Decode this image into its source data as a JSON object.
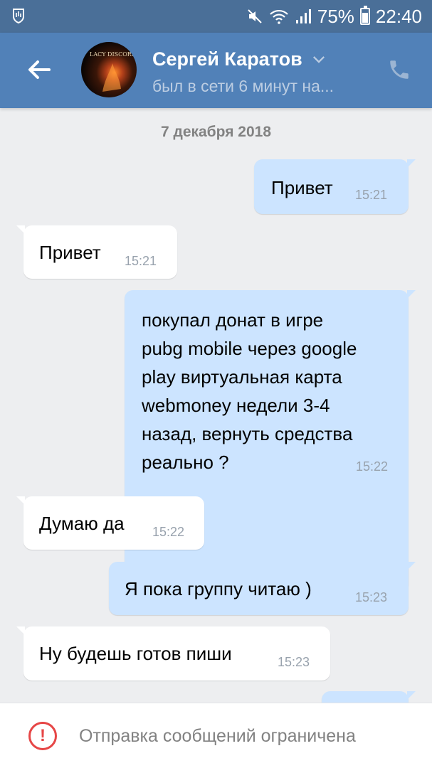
{
  "status_bar": {
    "battery_percent": "75%",
    "time": "22:40",
    "icons": [
      "hand-notification-icon",
      "mute-icon",
      "wifi-icon",
      "signal-icon",
      "battery-icon"
    ]
  },
  "header": {
    "contact_name": "Сергей Каратов",
    "last_seen": "был в сети 6 минут на...",
    "avatar_text": "LACY DISCORD",
    "colors": {
      "header_bg": "#5181b8",
      "status_bar_bg": "#4a6f98"
    }
  },
  "chat": {
    "date": "7 декабря 2018",
    "messages": [
      {
        "direction": "out",
        "text": "Привет",
        "time": "15:21"
      },
      {
        "direction": "in",
        "text": "Привет",
        "time": "15:21"
      },
      {
        "direction": "out",
        "lines": [
          "покупал донат в игре",
          "pubg mobile через google",
          "play виртуальная карта",
          "webmoney недели 3-4",
          "назад, вернуть средства",
          "реально ?"
        ],
        "time": "15:22"
      },
      {
        "direction": "in",
        "text": "Думаю да",
        "time": "15:22"
      },
      {
        "direction": "out",
        "text": "Я пока группу читаю )",
        "time": "15:23"
      },
      {
        "direction": "in",
        "text": "Ну будешь готов пиши",
        "time": "15:23"
      }
    ],
    "colors": {
      "outgoing_bubble": "#cce4ff",
      "incoming_bubble": "#ffffff",
      "background": "#edeef0"
    }
  },
  "bottom_bar": {
    "text": "Отправка сообщений ограничена",
    "icon": "warning-icon",
    "icon_glyph": "!",
    "colors": {
      "warning": "#e64646"
    }
  }
}
